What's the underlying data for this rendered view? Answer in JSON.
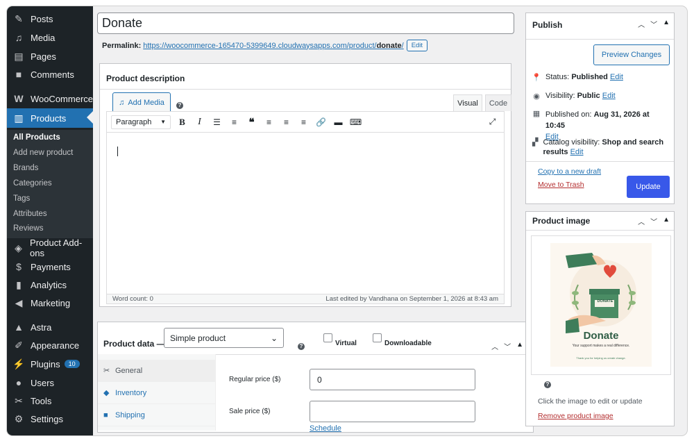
{
  "sidebar": {
    "items": [
      {
        "label": "Posts",
        "icon": "pin-icon"
      },
      {
        "label": "Media",
        "icon": "media-icon"
      },
      {
        "label": "Pages",
        "icon": "pages-icon"
      },
      {
        "label": "Comments",
        "icon": "comments-icon"
      },
      {
        "label": "WooCommerce",
        "icon": "woocommerce-icon"
      },
      {
        "label": "Products",
        "icon": "products-icon"
      },
      {
        "label": "Product Add-ons",
        "icon": "addons-icon"
      },
      {
        "label": "Payments",
        "icon": "payments-icon"
      },
      {
        "label": "Analytics",
        "icon": "analytics-icon"
      },
      {
        "label": "Marketing",
        "icon": "megaphone-icon"
      },
      {
        "label": "Astra",
        "icon": "astra-icon"
      },
      {
        "label": "Appearance",
        "icon": "brush-icon"
      },
      {
        "label": "Plugins",
        "icon": "plug-icon",
        "badge": "10"
      },
      {
        "label": "Users",
        "icon": "user-icon"
      },
      {
        "label": "Tools",
        "icon": "wrench-icon"
      },
      {
        "label": "Settings",
        "icon": "settings-icon"
      }
    ],
    "submenu": [
      "All Products",
      "Add new product",
      "Brands",
      "Categories",
      "Tags",
      "Attributes",
      "Reviews"
    ]
  },
  "post": {
    "title": "Donate",
    "permalink_label": "Permalink:",
    "permalink_base": "https://woocommerce-165470-5399649.cloudwaysapps.com/product/",
    "permalink_slug": "donate",
    "permalink_end": "/",
    "edit_label": "Edit"
  },
  "description": {
    "title": "Product description",
    "add_media": "Add Media",
    "tab_visual": "Visual",
    "tab_code": "Code",
    "format": "Paragraph",
    "word_count": "Word count: 0",
    "last_edited": "Last edited by Vandhana on September 1, 2026 at 8:43 am"
  },
  "product_data": {
    "title": "Product data —",
    "type": "Simple product",
    "virtual": "Virtual",
    "downloadable": "Downloadable",
    "tabs": [
      "General",
      "Inventory",
      "Shipping"
    ],
    "regular_price_label": "Regular price ($)",
    "regular_price": "0",
    "sale_price_label": "Sale price ($)",
    "sale_price": "",
    "schedule": "Schedule"
  },
  "publish": {
    "title": "Publish",
    "preview": "Preview Changes",
    "status_label": "Status:",
    "status": "Published",
    "visibility_label": "Visibility:",
    "visibility": "Public",
    "published_label": "Published on:",
    "published": "Aug 31, 2026 at 10:45",
    "catalog_label": "Catalog visibility:",
    "catalog": "Shop and search results",
    "edit": "Edit",
    "copy_draft": "Copy to a new draft",
    "trash": "Move to Trash",
    "update": "Update"
  },
  "product_image": {
    "title": "Product image",
    "img_heading": "Donate",
    "img_box_label": "DONATE",
    "img_sub": "Your support makes a real difference.",
    "img_thanks": "Thank you for helping us create change.",
    "hint": "Click the image to edit or update",
    "remove": "Remove product image"
  },
  "colors": {
    "accent": "#2271b1",
    "sidebar": "#1d2327",
    "update": "#3858e9",
    "trash": "#b32d2e"
  }
}
